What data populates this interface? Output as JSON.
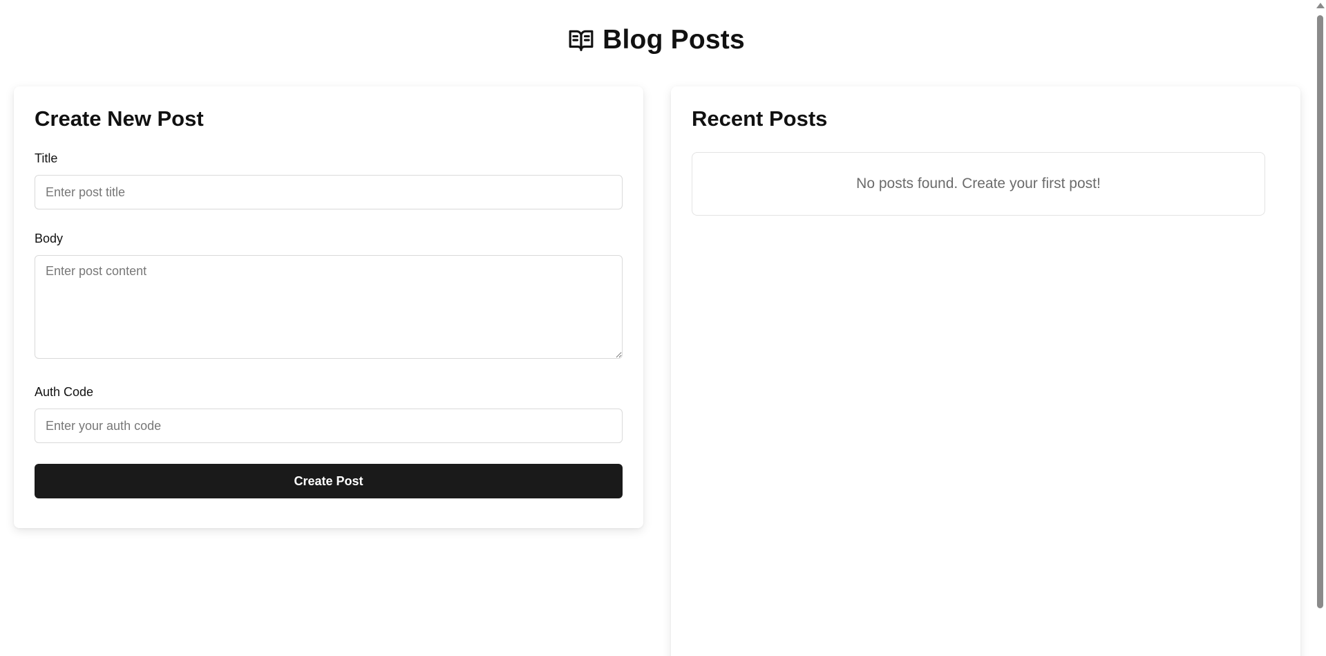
{
  "header": {
    "title": "Blog Posts",
    "icon": "book-open-icon"
  },
  "create_form": {
    "heading": "Create New Post",
    "title_label": "Title",
    "title_placeholder": "Enter post title",
    "title_value": "",
    "body_label": "Body",
    "body_placeholder": "Enter post content",
    "body_value": "",
    "auth_label": "Auth Code",
    "auth_placeholder": "Enter your auth code",
    "auth_value": "",
    "submit_label": "Create Post"
  },
  "recent": {
    "heading": "Recent Posts",
    "empty_message": "No posts found. Create your first post!",
    "posts": []
  },
  "colors": {
    "primary_button": "#1a1a1a",
    "placeholder_text": "#777777",
    "border": "#d9d9d9"
  }
}
